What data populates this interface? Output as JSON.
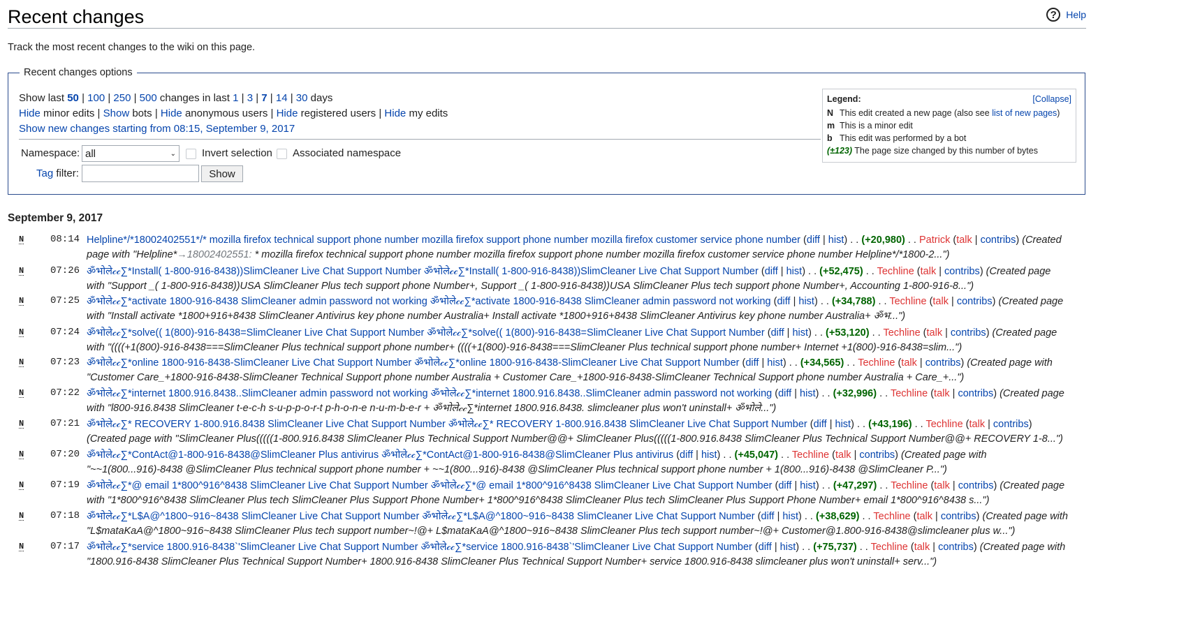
{
  "header": {
    "title": "Recent changes",
    "help_label": "Help",
    "help_icon": "?"
  },
  "intro": "Track the most recent changes to the wiki on this page.",
  "options": {
    "legend": "Recent changes options",
    "show_last_prefix": "Show last",
    "limits": [
      "50",
      "100",
      "250",
      "500"
    ],
    "limit_selected": "50",
    "changes_in_last": "changes in last",
    "days": [
      "1",
      "3",
      "7",
      "14",
      "30"
    ],
    "days_selected": "7",
    "days_suffix": "days",
    "toggles": [
      {
        "action": "Hide",
        "label": "minor edits"
      },
      {
        "action": "Show",
        "label": "bots"
      },
      {
        "action": "Hide",
        "label": "anonymous users"
      },
      {
        "action": "Hide",
        "label": "registered users"
      },
      {
        "action": "Hide",
        "label": "my edits"
      }
    ],
    "show_new": "Show new changes starting from 08:15, September 9, 2017",
    "namespace_label": "Namespace:",
    "namespace_value": "all",
    "invert_label": "Invert selection",
    "assoc_label": "Associated namespace",
    "tag_label": "Tag",
    "filter_label": " filter:",
    "show_button": "Show"
  },
  "legend": {
    "title": "Legend:",
    "collapse": "[Collapse]",
    "rows": [
      {
        "key": "N",
        "text": "This edit created a new page (also see ",
        "link": "list of new pages",
        "after": ")"
      },
      {
        "key": "m",
        "text": "This is a minor edit",
        "link": "",
        "after": ""
      },
      {
        "key": "b",
        "text": "This edit was performed by a bot",
        "link": "",
        "after": ""
      },
      {
        "key": "(±123)",
        "text": "The page size changed by this number of bytes",
        "link": "",
        "after": ""
      }
    ]
  },
  "date_heading": "September 9, 2017",
  "entries": [
    {
      "flag": "N",
      "time": "08:14",
      "title": "Helpline*/*18002402551*/* mozilla firefox technical support phone number mozilla firefox support phone number mozilla firefox customer service phone number",
      "size": "(+20,980)",
      "user": "Patrick",
      "summary_pre": "(Created",
      "summary2": "page with \"Helpline*",
      "summary2_gray": "→18002402551:",
      "summary2_rest": " * mozilla firefox technical support phone number mozilla firefox support phone number mozilla firefox customer service phone number Helpline*/*1800-2...\")"
    },
    {
      "flag": "N",
      "time": "07:26",
      "title": "ॐभोले𝒸𝒸∑*Install( 1-800-916-8438))SlimCleaner Live Chat Support Number ॐभोले𝒸𝒸∑*Install( 1-800-916-8438))SlimCleaner Live Chat Support Number",
      "size": "(+52,475)",
      "user": "Techline",
      "summary_pre": "(Created page",
      "summary2": "with \"Support _( 1-800-916-8438))USA SlimCleaner Plus tech support phone Number+, Support _( 1-800-916-8438))USA SlimCleaner Plus tech support phone Number+, Accounting 1-800-916-8...\")",
      "summary2_gray": "",
      "summary2_rest": ""
    },
    {
      "flag": "N",
      "time": "07:25",
      "title": "ॐभोले𝒸𝒸∑*activate 1800-916-8438 SlimCleaner admin password not working ॐभोले𝒸𝒸∑*activate 1800-916-8438 SlimCleaner admin password not working",
      "size": "(+34,788)",
      "user": "Techline",
      "summary_pre": "(Created page",
      "summary2": "with \"Install activate *1800+916+8438 SlimCleaner Antivirus key phone number Australia+ Install activate *1800+916+8438 SlimCleaner Antivirus key phone number Australia+ ॐभ...\")",
      "summary2_gray": "",
      "summary2_rest": ""
    },
    {
      "flag": "N",
      "time": "07:24",
      "title": "ॐभोले𝒸𝒸∑*solve(( 1(800)-916-8438=SlimCleaner Live Chat Support Number ॐभोले𝒸𝒸∑*solve(( 1(800)-916-8438=SlimCleaner Live Chat Support Number",
      "size": "(+53,120)",
      "user": "Techline",
      "summary_pre": "(Created page",
      "summary2": "with \"((((+1(800)-916-8438===SlimCleaner Plus technical support phone number+ ((((+1(800)-916-8438===SlimCleaner Plus technical support phone number+ Internet +1(800)-916-8438=slim...\")",
      "summary2_gray": "",
      "summary2_rest": ""
    },
    {
      "flag": "N",
      "time": "07:23",
      "title": "ॐभोले𝒸𝒸∑*online 1800-916-8438-SlimCleaner Live Chat Support Number ॐभोले𝒸𝒸∑*online 1800-916-8438-SlimCleaner Live Chat Support Number",
      "size": "(+34,565)",
      "user": "Techline",
      "summary_pre": "(Created page with",
      "summary2": "\"Customer Care_+1800-916-8438-SlimCleaner Technical Support phone number Australia + Customer Care_+1800-916-8438-SlimCleaner Technical Support phone number Australia + Care_+...\")",
      "summary2_gray": "",
      "summary2_rest": ""
    },
    {
      "flag": "N",
      "time": "07:22",
      "title": "ॐभोले𝒸𝒸∑*internet 1800.916.8438..SlimCleaner admin password not working ॐभोले𝒸𝒸∑*internet 1800.916.8438..SlimCleaner admin password not working",
      "size": "(+32,996)",
      "user": "Techline",
      "summary_pre": "(Created page",
      "summary2": "with \"l800-916.8438 SlimCleaner t-e-c-h s-u-p-p-o-r-t p-h-o-n-e n-u-m-b-e-r + ॐभोले𝒸𝒸∑*internet 1800.916.8438. slimcleaner plus won't uninstall+ ॐभोले...\")",
      "summary2_gray": "",
      "summary2_rest": ""
    },
    {
      "flag": "N",
      "time": "07:21",
      "title": "ॐभोले𝒸𝒸∑* RECOVERY 1-800.916.8438 SlimCleaner Live Chat Support Number ॐभोले𝒸𝒸∑* RECOVERY 1-800.916.8438 SlimCleaner Live Chat Support Number",
      "size": "(+43,196)",
      "user": "Techline",
      "summary_pre": "",
      "summary2": "(Created page with \"SlimCleaner Plus(((((1-800.916.8438 SlimCleaner Plus Technical Support Number@@+ SlimCleaner Plus(((((1-800.916.8438 SlimCleaner Plus Technical Support Number@@+ RECOVERY 1-8...\")",
      "summary2_gray": "",
      "summary2_rest": ""
    },
    {
      "flag": "N",
      "time": "07:20",
      "title": "ॐभोले𝒸𝒸∑*ContAct@1-800-916-8438@SlimCleaner Plus antivirus ॐभोले𝒸𝒸∑*ContAct@1-800-916-8438@SlimCleaner Plus antivirus",
      "size": "(+45,047)",
      "user": "Techline",
      "summary_pre": "(Created page with",
      "summary2": "\"~~1(800...916)-8438 @SlimCleaner Plus technical support phone number + ~~1(800...916)-8438 @SlimCleaner Plus technical support phone number + 1(800...916)-8438 @SlimCleaner P...\")",
      "summary2_gray": "",
      "summary2_rest": ""
    },
    {
      "flag": "N",
      "time": "07:19",
      "title": "ॐभोले𝒸𝒸∑*@ email 1*800^916^8438 SlimCleaner Live Chat Support Number ॐभोले𝒸𝒸∑*@ email 1*800^916^8438 SlimCleaner Live Chat Support Number",
      "size": "(+47,297)",
      "user": "Techline",
      "summary_pre": "(Created page",
      "summary2": "with \"1*800^916^8438 SlimCleaner Plus tech SlimCleaner Plus Support Phone Number+ 1*800^916^8438 SlimCleaner Plus tech SlimCleaner Plus Support Phone Number+ email 1*800^916^8438 s...\")",
      "summary2_gray": "",
      "summary2_rest": ""
    },
    {
      "flag": "N",
      "time": "07:18",
      "title": "ॐभोले𝒸𝒸∑*L$A@^1800~916~8438 SlimCleaner Live Chat Support Number ॐभोले𝒸𝒸∑*L$A@^1800~916~8438 SlimCleaner Live Chat Support Number",
      "size": "(+38,629)",
      "user": "Techline",
      "summary_pre": "(Created page with",
      "summary2": "\"L$mataKaA@^1800~916~8438 SlimCleaner Plus tech support number~!@+ L$mataKaA@^1800~916~8438 SlimCleaner Plus tech support number~!@+ Customer@1.800-916-8438@slimcleaner plus w...\")",
      "summary2_gray": "",
      "summary2_rest": ""
    },
    {
      "flag": "N",
      "time": "07:17",
      "title": "ॐभोले𝒸𝒸∑*service 1800.916-8438`'SlimCleaner Live Chat Support Number ॐभोले𝒸𝒸∑*service 1800.916-8438`'SlimCleaner Live Chat Support Number",
      "size": "(+75,737)",
      "user": "Techline",
      "summary_pre": "(Created page with",
      "summary2": "\"1800.916-8438 SlimCleaner Plus Technical Support Number+ 1800.916-8438 SlimCleaner Plus Technical Support Number+ service 1800.916-8438 slimcleaner plus won't uninstall+ serv...\")",
      "summary2_gray": "",
      "summary2_rest": ""
    }
  ],
  "labels": {
    "diff": "diff",
    "hist": "hist",
    "talk": "talk",
    "contribs": "contribs",
    "sep": ". ."
  }
}
